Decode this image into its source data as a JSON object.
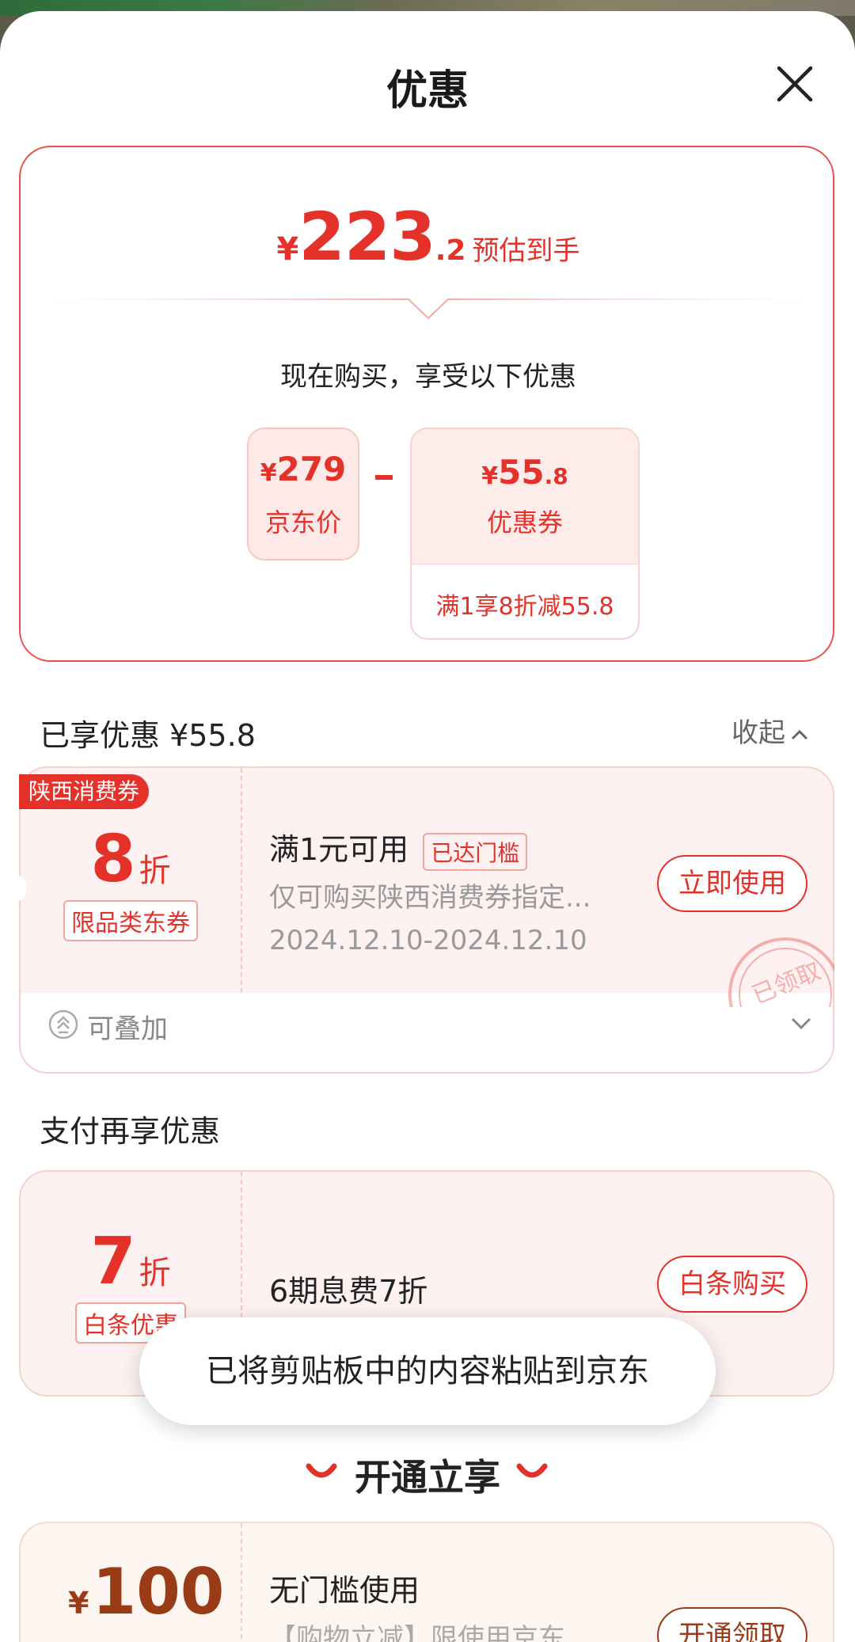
{
  "sheet": {
    "title": "优惠"
  },
  "summary": {
    "currency": "¥",
    "est_int": "223",
    "est_dec": ".2",
    "est_label": "预估到手",
    "now_text": "现在购买，享受以下优惠",
    "jd_price_value": "279",
    "jd_price_label": "京东价",
    "coupon_value_int": "55",
    "coupon_value_dec": ".8",
    "coupon_label": "优惠券",
    "coupon_condition": "满1享8折减55.8"
  },
  "enjoyed": {
    "title": "已享优惠 ¥55.8",
    "collapse_label": "收起"
  },
  "coupon1": {
    "region_tag": "陕西消费券",
    "discount": "8",
    "unit": "折",
    "type_tag": "限品类东券",
    "title": "满1元可用",
    "badge": "已达门槛",
    "desc": "仅可购买陕西消费券指定...",
    "date": "2024.12.10-2024.12.10",
    "button": "立即使用",
    "stamp": "已领取",
    "stackable": "可叠加"
  },
  "pay_section": {
    "title": "支付再享优惠"
  },
  "coupon2": {
    "discount": "7",
    "unit": "折",
    "type_tag": "白条优惠",
    "title": "6期息费7折",
    "button": "白条购买"
  },
  "toast": {
    "text": "已将剪贴板中的内容粘贴到京东"
  },
  "open_section": {
    "title": "开通立享"
  },
  "coupon3": {
    "currency": "¥",
    "amount": "100",
    "title": "无门槛使用",
    "desc": "【购物立减】限使用京东...",
    "button": "开通领取"
  },
  "colors": {
    "accent": "#e4322b",
    "card_bg": "#fdf2f1",
    "vip_text": "#9a3b18"
  }
}
